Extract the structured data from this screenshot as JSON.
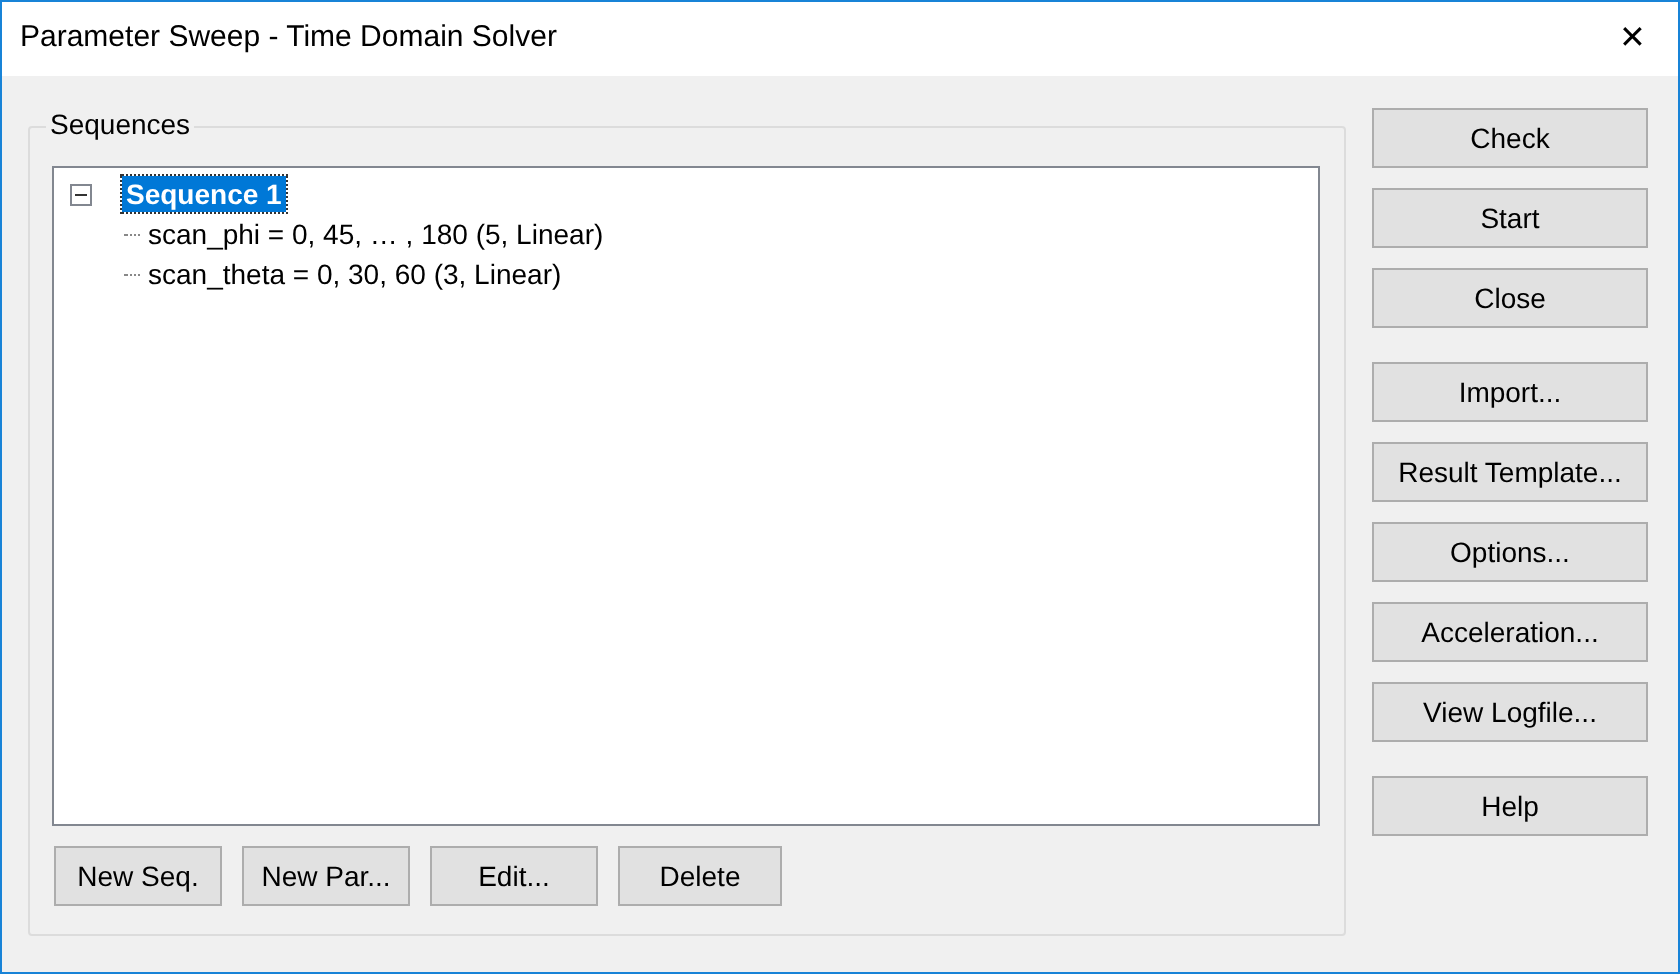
{
  "window": {
    "title": "Parameter Sweep - Time Domain Solver",
    "close": "✕"
  },
  "sequences": {
    "label": "Sequences",
    "tree": [
      {
        "label": "Sequence 1",
        "selected": true,
        "expanded": true,
        "children": [
          {
            "label": "scan_phi = 0, 45, … , 180 (5, Linear)",
            "selected": false
          },
          {
            "label": "scan_theta = 0, 30, 60 (3, Linear)",
            "selected": false
          }
        ]
      }
    ],
    "buttons": [
      "New Seq.",
      "New Par...",
      "Edit...",
      "Delete"
    ]
  },
  "button_groups": [
    [
      "Check",
      "Start",
      "Close"
    ],
    [
      "Import...",
      "Result Template...",
      "Options...",
      "Acceleration...",
      "View Logfile..."
    ],
    [
      "Help"
    ]
  ]
}
